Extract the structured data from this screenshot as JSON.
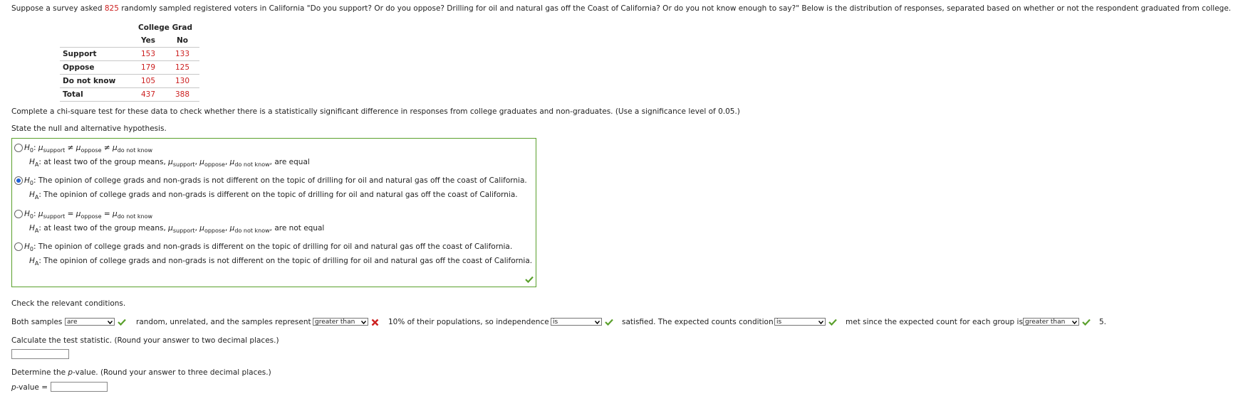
{
  "intro": {
    "prefix": "Suppose a survey asked ",
    "count": "825",
    "rest": " randomly sampled registered voters in California \"Do you support? Or do you oppose? Drilling for oil and natural gas off the Coast of California? Or do you not know enough to say?\" Below is the distribution of responses, separated based on whether or not the respondent graduated from college."
  },
  "table": {
    "group_header": "College Grad",
    "col_yes": "Yes",
    "col_no": "No",
    "rows": [
      {
        "label": "Support",
        "yes": "153",
        "no": "133"
      },
      {
        "label": "Oppose",
        "yes": "179",
        "no": "125"
      },
      {
        "label": "Do not know",
        "yes": "105",
        "no": "130"
      },
      {
        "label": "Total",
        "yes": "437",
        "no": "388"
      }
    ]
  },
  "instructions": "Complete a chi-square test for these data to check whether there is a statistically significant difference in responses from college graduates and non-graduates. (Use a significance level of 0.05.)",
  "hypothesis_prompt": "State the null and alternative hypothesis.",
  "options": {
    "o1": {
      "h0_sym": "H",
      "h0_sub": "0",
      "mu": "μ",
      "s1": "support",
      "s2": "oppose",
      "s3": "do not know",
      "rel": "≠",
      "ha_text": ": at least two of the group means, ",
      "ha_tail": " are equal"
    },
    "o2": {
      "h0": ": The opinion of college grads and non-grads is not different on the topic of drilling for oil and natural gas off the coast of California.",
      "ha": ": The opinion of college grads and non-grads is different on the topic of drilling for oil and natural gas off the coast of California."
    },
    "o3": {
      "rel": "=",
      "ha_tail": " are not equal"
    },
    "o4": {
      "h0": ": The opinion of college grads and non-grads is different on the topic of drilling for oil and natural gas off the coast of California.",
      "ha": ": The opinion of college grads and non-grads is not different on the topic of drilling for oil and natural gas off the coast of California."
    },
    "selected": 2
  },
  "conditions": {
    "prompt": "Check the relevant conditions.",
    "t1": "Both samples",
    "sel1": "are",
    "t2": "random, unrelated, and the samples represent",
    "sel2": "greater than",
    "t3": "10% of their populations, so independence",
    "sel3": "is",
    "t4": "satisfied. The expected counts condition",
    "sel4": "is",
    "t5": "met since the expected count for each group is",
    "sel5": "greater than",
    "t6": "5."
  },
  "test_stat_prompt": "Calculate the test statistic. (Round your answer to two decimal places.)",
  "pvalue_prompt_a": "Determine the ",
  "pvalue_prompt_p": "p",
  "pvalue_prompt_b": "-value. (Round your answer to three decimal places.)",
  "pvalue_label_p": "p",
  "pvalue_label_rest": "-value =",
  "colors": {
    "accent_green": "#5aa02c",
    "error_red": "#cc2020",
    "radio_blue": "#1d62d8"
  }
}
